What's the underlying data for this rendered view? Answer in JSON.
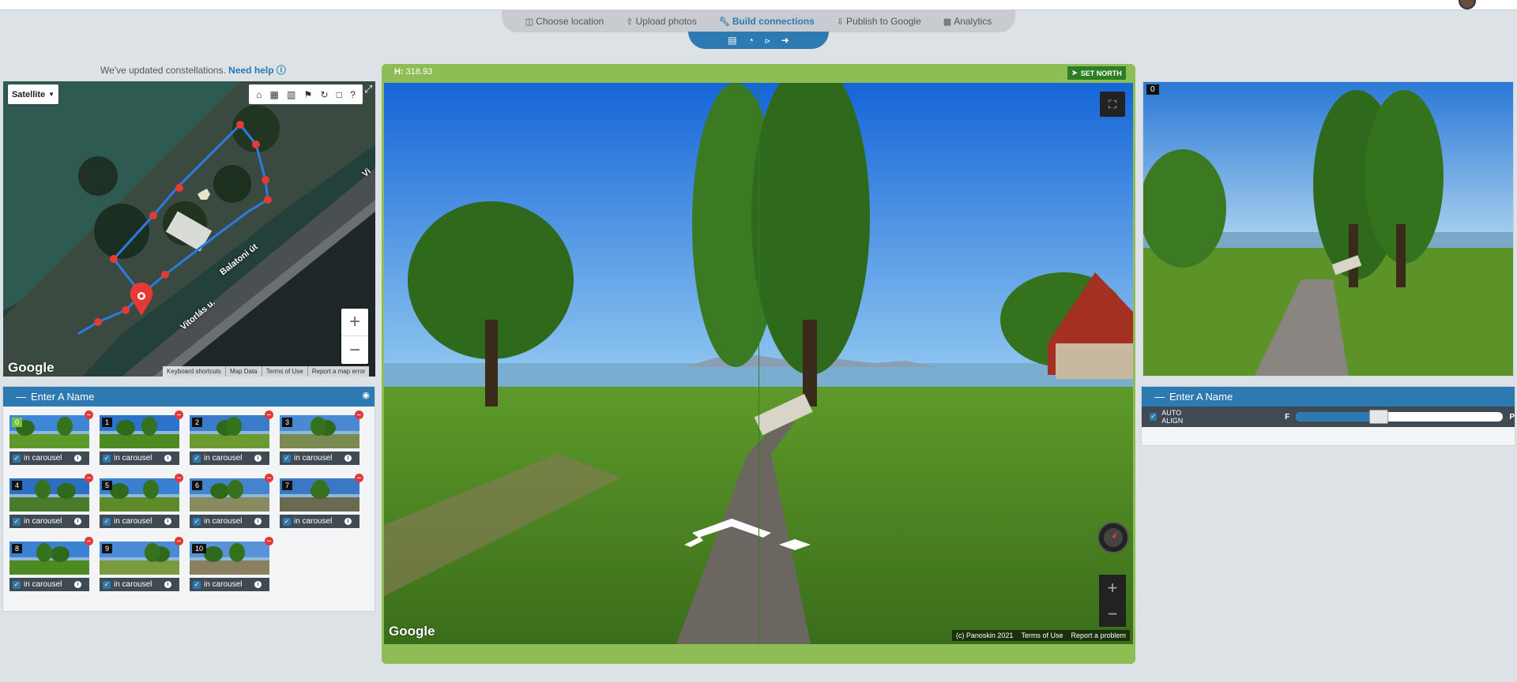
{
  "nav": {
    "tabs": [
      {
        "icon": "map-icon",
        "label": "Choose location"
      },
      {
        "icon": "upload-icon",
        "label": "Upload photos"
      },
      {
        "icon": "wrench-icon",
        "label": "Build connections",
        "active": true
      },
      {
        "icon": "download-icon",
        "label": "Publish to Google"
      },
      {
        "icon": "bar-chart-icon",
        "label": "Analytics"
      }
    ],
    "actions": [
      "save-icon",
      "history-icon",
      "share-icon",
      "exit-icon"
    ]
  },
  "notice": {
    "text": "We've updated constellations. ",
    "link": "Need help"
  },
  "map": {
    "type_label": "Satellite",
    "tools": [
      "home-icon",
      "lock-icon",
      "unlock-icon",
      "tags-icon",
      "refresh-icon",
      "select-area-icon",
      "help-icon"
    ],
    "streets": [
      "Balatoni út",
      "Vitorlás u.",
      "Vi"
    ],
    "logo": "Google",
    "footer": [
      "Keyboard shortcuts",
      "Map Data",
      "Terms of Use",
      "Report a map error"
    ]
  },
  "left_panel": {
    "title": "Enter A Name",
    "thumbs": [
      {
        "num": "0",
        "label": "in carousel"
      },
      {
        "num": "1",
        "label": "in carousel"
      },
      {
        "num": "2",
        "label": "in carousel"
      },
      {
        "num": "3",
        "label": "in carousel"
      },
      {
        "num": "4",
        "label": "in carousel"
      },
      {
        "num": "5",
        "label": "in carousel"
      },
      {
        "num": "6",
        "label": "in carousel"
      },
      {
        "num": "7",
        "label": "in carousel"
      },
      {
        "num": "8",
        "label": "in carousel"
      },
      {
        "num": "9",
        "label": "in carousel"
      },
      {
        "num": "10",
        "label": "in carousel"
      }
    ]
  },
  "viewer": {
    "heading_label": "H:",
    "heading_value": "318.93",
    "set_north": "SET NORTH",
    "logo": "Google",
    "footer": [
      "(c) Panoskin 2021",
      "Terms of Use",
      "Report a problem"
    ]
  },
  "preview": {
    "num": "0"
  },
  "right_panel": {
    "title": "Enter A Name",
    "auto_align": "AUTO ALIGN",
    "slider_left": "F",
    "slider_right": "P",
    "slider_value": 0.37
  },
  "colors": {
    "accent": "#2d7ab3",
    "green": "#8fbd55",
    "dark_green": "#2c7d24",
    "remove": "#e53935"
  }
}
